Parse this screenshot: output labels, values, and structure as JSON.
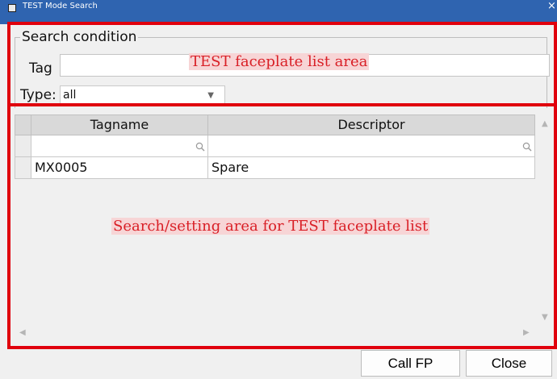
{
  "window": {
    "title": "TEST Mode Search",
    "close_glyph": "×"
  },
  "search": {
    "group_title": "Search condition",
    "tag_label": "Tag",
    "tag_value": "",
    "type_label": "Type:",
    "type_value": "all"
  },
  "grid": {
    "columns": [
      "Tagname",
      "Descriptor"
    ],
    "rows": [
      {
        "tagname": "MX0005",
        "descriptor": "Spare"
      }
    ]
  },
  "annotations": {
    "top_label": "TEST faceplate list area",
    "bottom_label": "Search/setting area for TEST faceplate list",
    "color": "#e0000d"
  },
  "buttons": {
    "call_fp": "Call FP",
    "close": "Close"
  },
  "icons": {
    "magnifier": "magnifier-icon",
    "type_chevron": "chevron-down-icon",
    "scroll_up": "scroll-up-icon",
    "scroll_down": "scroll-down-icon",
    "scroll_left": "scroll-left-icon",
    "scroll_right": "scroll-right-icon"
  },
  "colors": {
    "titlebar": "#2f64b0",
    "annotation_fill": "#f7d5d6"
  }
}
